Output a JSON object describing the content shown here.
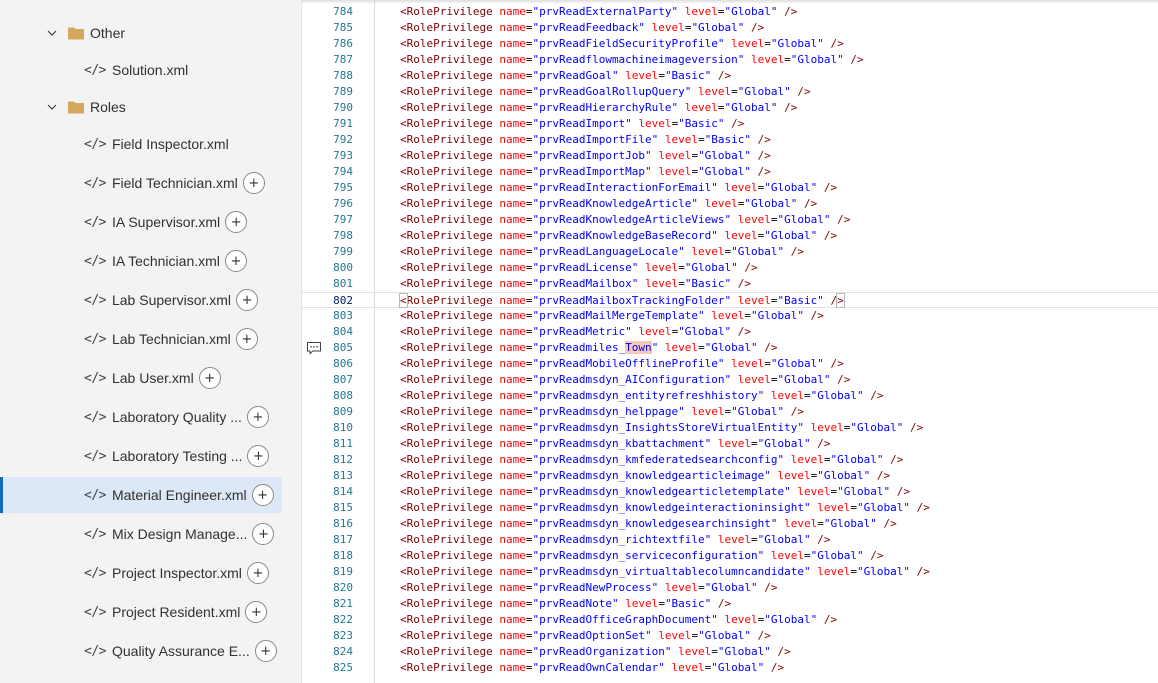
{
  "sidebar": {
    "folders": [
      {
        "label": "Other",
        "expanded": true
      },
      {
        "label": "Roles",
        "expanded": true
      }
    ],
    "other_files": [
      "Solution.xml"
    ],
    "role_files": [
      {
        "label": "Field Inspector.xml",
        "plus": false
      },
      {
        "label": "Field Technician.xml",
        "plus": true
      },
      {
        "label": "IA Supervisor.xml",
        "plus": true
      },
      {
        "label": "IA Technician.xml",
        "plus": true
      },
      {
        "label": "Lab Supervisor.xml",
        "plus": true
      },
      {
        "label": "Lab Technician.xml",
        "plus": true
      },
      {
        "label": "Lab User.xml",
        "plus": true
      },
      {
        "label": "Laboratory Quality ...",
        "plus": true
      },
      {
        "label": "Laboratory Testing ...",
        "plus": true
      },
      {
        "label": "Material Engineer.xml",
        "plus": true,
        "selected": true
      },
      {
        "label": "Mix Design Manage...",
        "plus": true
      },
      {
        "label": "Project Inspector.xml",
        "plus": true
      },
      {
        "label": "Project Resident.xml",
        "plus": true
      },
      {
        "label": "Quality Assurance E...",
        "plus": true
      }
    ],
    "file_icon_glyph": "</>",
    "plus_glyph": "+"
  },
  "editor": {
    "tag_name": "<RolePrivilege",
    "attr_name": "name",
    "attr_level": "level",
    "close": "/>",
    "current_line": 802,
    "comment_line": 805,
    "lines": [
      {
        "n": 784,
        "name": "prvReadExternalParty",
        "level": "Global"
      },
      {
        "n": 785,
        "name": "prvReadFeedback",
        "level": "Global"
      },
      {
        "n": 786,
        "name": "prvReadFieldSecurityProfile",
        "level": "Global"
      },
      {
        "n": 787,
        "name": "prvReadflowmachineimageversion",
        "level": "Global"
      },
      {
        "n": 788,
        "name": "prvReadGoal",
        "level": "Basic"
      },
      {
        "n": 789,
        "name": "prvReadGoalRollupQuery",
        "level": "Global"
      },
      {
        "n": 790,
        "name": "prvReadHierarchyRule",
        "level": "Global"
      },
      {
        "n": 791,
        "name": "prvReadImport",
        "level": "Basic"
      },
      {
        "n": 792,
        "name": "prvReadImportFile",
        "level": "Basic"
      },
      {
        "n": 793,
        "name": "prvReadImportJob",
        "level": "Global"
      },
      {
        "n": 794,
        "name": "prvReadImportMap",
        "level": "Global"
      },
      {
        "n": 795,
        "name": "prvReadInteractionForEmail",
        "level": "Global"
      },
      {
        "n": 796,
        "name": "prvReadKnowledgeArticle",
        "level": "Global"
      },
      {
        "n": 797,
        "name": "prvReadKnowledgeArticleViews",
        "level": "Global"
      },
      {
        "n": 798,
        "name": "prvReadKnowledgeBaseRecord",
        "level": "Global"
      },
      {
        "n": 799,
        "name": "prvReadLanguageLocale",
        "level": "Global"
      },
      {
        "n": 800,
        "name": "prvReadLicense",
        "level": "Global"
      },
      {
        "n": 801,
        "name": "prvReadMailbox",
        "level": "Basic"
      },
      {
        "n": 802,
        "name": "prvReadMailboxTrackingFolder",
        "level": "Basic"
      },
      {
        "n": 803,
        "name": "prvReadMailMergeTemplate",
        "level": "Global"
      },
      {
        "n": 804,
        "name": "prvReadMetric",
        "level": "Global"
      },
      {
        "n": 805,
        "name": "prvReadmiles_Town",
        "level": "Global",
        "highlight": "Town"
      },
      {
        "n": 806,
        "name": "prvReadMobileOfflineProfile",
        "level": "Global"
      },
      {
        "n": 807,
        "name": "prvReadmsdyn_AIConfiguration",
        "level": "Global"
      },
      {
        "n": 808,
        "name": "prvReadmsdyn_entityrefreshhistory",
        "level": "Global"
      },
      {
        "n": 809,
        "name": "prvReadmsdyn_helppage",
        "level": "Global"
      },
      {
        "n": 810,
        "name": "prvReadmsdyn_InsightsStoreVirtualEntity",
        "level": "Global"
      },
      {
        "n": 811,
        "name": "prvReadmsdyn_kbattachment",
        "level": "Global"
      },
      {
        "n": 812,
        "name": "prvReadmsdyn_kmfederatedsearchconfig",
        "level": "Global"
      },
      {
        "n": 813,
        "name": "prvReadmsdyn_knowledgearticleimage",
        "level": "Global"
      },
      {
        "n": 814,
        "name": "prvReadmsdyn_knowledgearticletemplate",
        "level": "Global"
      },
      {
        "n": 815,
        "name": "prvReadmsdyn_knowledgeinteractioninsight",
        "level": "Global"
      },
      {
        "n": 816,
        "name": "prvReadmsdyn_knowledgesearchinsight",
        "level": "Global"
      },
      {
        "n": 817,
        "name": "prvReadmsdyn_richtextfile",
        "level": "Global"
      },
      {
        "n": 818,
        "name": "prvReadmsdyn_serviceconfiguration",
        "level": "Global"
      },
      {
        "n": 819,
        "name": "prvReadmsdyn_virtualtablecolumncandidate",
        "level": "Global"
      },
      {
        "n": 820,
        "name": "prvReadNewProcess",
        "level": "Global"
      },
      {
        "n": 821,
        "name": "prvReadNote",
        "level": "Basic"
      },
      {
        "n": 822,
        "name": "prvReadOfficeGraphDocument",
        "level": "Global"
      },
      {
        "n": 823,
        "name": "prvReadOptionSet",
        "level": "Global"
      },
      {
        "n": 824,
        "name": "prvReadOrganization",
        "level": "Global"
      },
      {
        "n": 825,
        "name": "prvReadOwnCalendar",
        "level": "Global"
      }
    ]
  }
}
